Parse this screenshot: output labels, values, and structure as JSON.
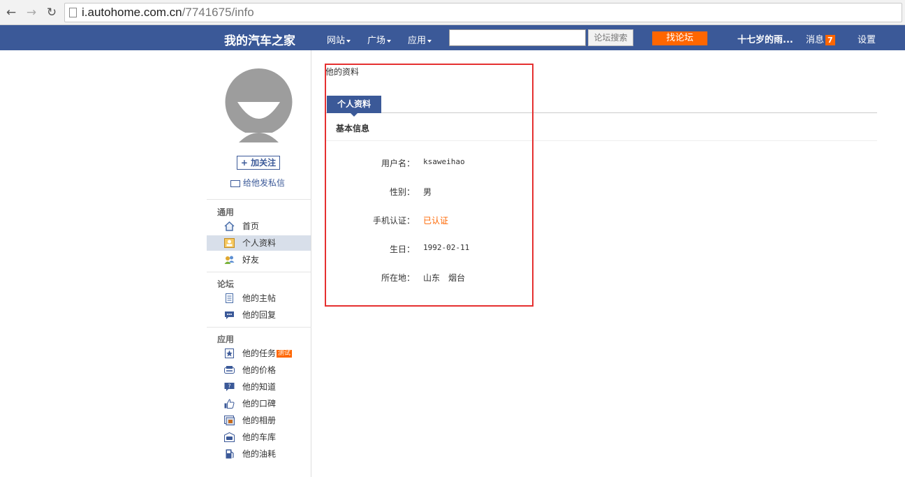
{
  "browser": {
    "back_glyph": "←",
    "forward_glyph": "→",
    "reload_glyph": "↻",
    "url_host": "i.autohome.com.cn",
    "url_path": "/7741675/info"
  },
  "topnav": {
    "brand": "我的汽车之家",
    "menus": [
      "网站",
      "广场",
      "应用"
    ],
    "search_placeholder": "",
    "search_button": "论坛搜索",
    "find_forum_button": "找论坛",
    "user_name": "十七岁的雨...",
    "messages_label": "消息",
    "messages_count": "7",
    "settings_label": "设置",
    "bar_color": "#3b5998",
    "accent_color": "#ff6600"
  },
  "sidebar": {
    "follow_button": "加关注",
    "follow_icon": "+",
    "pm_link": "给他发私信",
    "sections": [
      {
        "title": "通用",
        "items": [
          {
            "label": "首页",
            "icon": "home-icon"
          },
          {
            "label": "个人资料",
            "icon": "profile-card-icon",
            "active": true
          },
          {
            "label": "好友",
            "icon": "friends-icon"
          }
        ]
      },
      {
        "title": "论坛",
        "items": [
          {
            "label": "他的主帖",
            "icon": "document-icon"
          },
          {
            "label": "他的回复",
            "icon": "comment-icon"
          }
        ]
      },
      {
        "title": "应用",
        "items": [
          {
            "label": "他的任务",
            "icon": "star-icon",
            "badge": "测试"
          },
          {
            "label": "他的价格",
            "icon": "price-icon"
          },
          {
            "label": "他的知道",
            "icon": "question-icon"
          },
          {
            "label": "他的口碑",
            "icon": "thumbs-up-icon"
          },
          {
            "label": "他的相册",
            "icon": "album-icon"
          },
          {
            "label": "他的车库",
            "icon": "garage-icon"
          },
          {
            "label": "他的油耗",
            "icon": "fuel-icon"
          }
        ]
      }
    ]
  },
  "main": {
    "page_heading": "他的资料",
    "tab_label": "个人资料",
    "section_title": "基本信息",
    "fields": [
      {
        "label": "用户名：",
        "value": "ksaweihao"
      },
      {
        "label": "性别：",
        "value": "男"
      },
      {
        "label": "手机认证：",
        "value": "已认证"
      },
      {
        "label": "生日：",
        "value": "1992-02-11"
      },
      {
        "label": "所在地：",
        "value": "山东　烟台"
      }
    ]
  }
}
